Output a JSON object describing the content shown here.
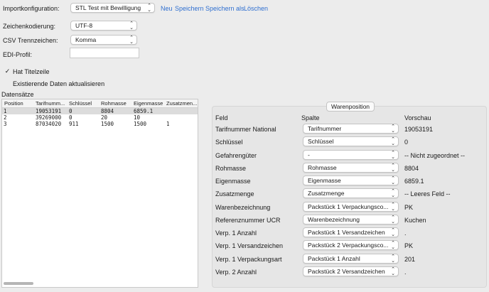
{
  "import": {
    "label": "Importkonfiguration:",
    "selected": "STL Test mit Bewilligung",
    "links": [
      "Neu",
      "Speichern",
      "Speichern als",
      "Löschen"
    ]
  },
  "encoding": {
    "label": "Zeichenkodierung:",
    "selected": "UTF-8"
  },
  "csv": {
    "label": "CSV Trennzeichen:",
    "selected": "Komma"
  },
  "edi": {
    "label": "EDI-Profil:",
    "value": ""
  },
  "options": {
    "hat_titelzeile": {
      "label": "Hat Titelzeile",
      "checked": true
    },
    "aktualisieren": {
      "label": "Existierende Daten aktualisieren",
      "checked": false
    }
  },
  "datasets": {
    "label": "Datensätze",
    "columns": [
      "Position",
      "Tarifnumm...",
      "Schlüssel",
      "Rohmasse",
      "Eigenmasse",
      "Zusatzmen..."
    ],
    "rows": [
      [
        "1",
        "19053191",
        "0",
        "8804",
        "6859.1",
        ""
      ],
      [
        "2",
        "39269000",
        "0",
        "20",
        "10",
        ""
      ],
      [
        "3",
        "87034020",
        "911",
        "1500",
        "1500",
        "1"
      ]
    ]
  },
  "warenposition": {
    "title": "Warenposition",
    "headers": {
      "feld": "Feld",
      "spalte": "Spalte",
      "vorschau": "Vorschau"
    },
    "rows": [
      {
        "feld": "Tarifnummer National",
        "spalte": "Tarifnummer",
        "vorschau": "19053191"
      },
      {
        "feld": "Schlüssel",
        "spalte": "Schlüssel",
        "vorschau": "0"
      },
      {
        "feld": "Gefahrengüter",
        "spalte": "-",
        "vorschau": "-- Nicht zugeordnet --"
      },
      {
        "feld": "Rohmasse",
        "spalte": "Rohmasse",
        "vorschau": "8804"
      },
      {
        "feld": "Eigenmasse",
        "spalte": "Eigenmasse",
        "vorschau": "6859.1"
      },
      {
        "feld": "Zusatzmenge",
        "spalte": "Zusatzmenge",
        "vorschau": "-- Leeres Feld --"
      },
      {
        "feld": "Warenbezeichnung",
        "spalte": "Packstück 1 Verpackungsco...",
        "vorschau": "PK"
      },
      {
        "feld": "Referenznummer UCR",
        "spalte": "Warenbezeichnung",
        "vorschau": "Kuchen"
      },
      {
        "feld": "Verp. 1 Anzahl",
        "spalte": "Packstück 1 Versandzeichen",
        "vorschau": "."
      },
      {
        "feld": "Verp. 1 Versandzeichen",
        "spalte": "Packstück 2 Verpackungsco...",
        "vorschau": "PK"
      },
      {
        "feld": "Verp. 1 Verpackungsart",
        "spalte": "Packstück 1 Anzahl",
        "vorschau": "201"
      },
      {
        "feld": "Verp. 2 Anzahl",
        "spalte": "Packstück 2 Versandzeichen",
        "vorschau": "."
      }
    ]
  }
}
